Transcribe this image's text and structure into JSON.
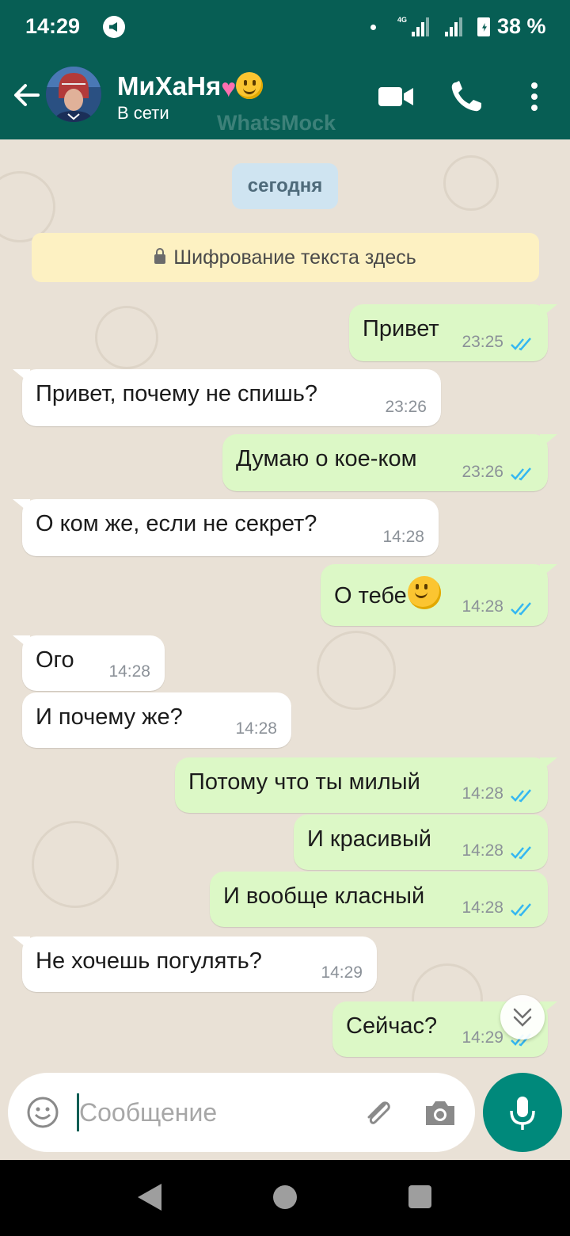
{
  "status_bar": {
    "time": "14:29",
    "network": "4G",
    "battery": "38 %"
  },
  "header": {
    "contact_name": "МиХаНя",
    "contact_status": "В сети",
    "watermark": "WhatsMock",
    "icons": [
      "back-arrow-icon",
      "video-call-icon",
      "phone-icon",
      "more-vert-icon"
    ]
  },
  "chat": {
    "date_chip": "сегодня",
    "encryption_notice": "Шифрование текста здесь",
    "messages": [
      {
        "dir": "out",
        "text": "Привет",
        "time": "23:25",
        "read": true
      },
      {
        "dir": "in",
        "text": "Привет, почему не спишь?",
        "time": "23:26"
      },
      {
        "dir": "out",
        "text": "Думаю о кое-ком",
        "time": "23:26",
        "read": true
      },
      {
        "dir": "in",
        "text": "О ком же, если не секрет?",
        "time": "14:28"
      },
      {
        "dir": "out",
        "text": "О тебе",
        "time": "14:28",
        "read": true,
        "emoji": "slightly-smiling-face"
      },
      {
        "dir": "in",
        "text": "Ого",
        "time": "14:28"
      },
      {
        "dir": "in",
        "text": "И почему же?",
        "time": "14:28"
      },
      {
        "dir": "out",
        "text": "Потому что ты милый",
        "time": "14:28",
        "read": true
      },
      {
        "dir": "out",
        "text": "И красивый",
        "time": "14:28",
        "read": true
      },
      {
        "dir": "out",
        "text": "И вообще класный",
        "time": "14:28",
        "read": true
      },
      {
        "dir": "in",
        "text": "Не хочешь погулять?",
        "time": "14:29"
      },
      {
        "dir": "out",
        "text": "Сейчас?",
        "time": "14:29",
        "read": true
      }
    ]
  },
  "input": {
    "placeholder": "Сообщение",
    "icons": [
      "emoji-icon",
      "attach-icon",
      "camera-icon",
      "mic-icon"
    ]
  },
  "colors": {
    "header": "#075e54",
    "outgoing_bubble": "#dcf8c6",
    "incoming_bubble": "#ffffff",
    "read_ticks": "#34b7f1",
    "mic_button": "#00897b"
  }
}
